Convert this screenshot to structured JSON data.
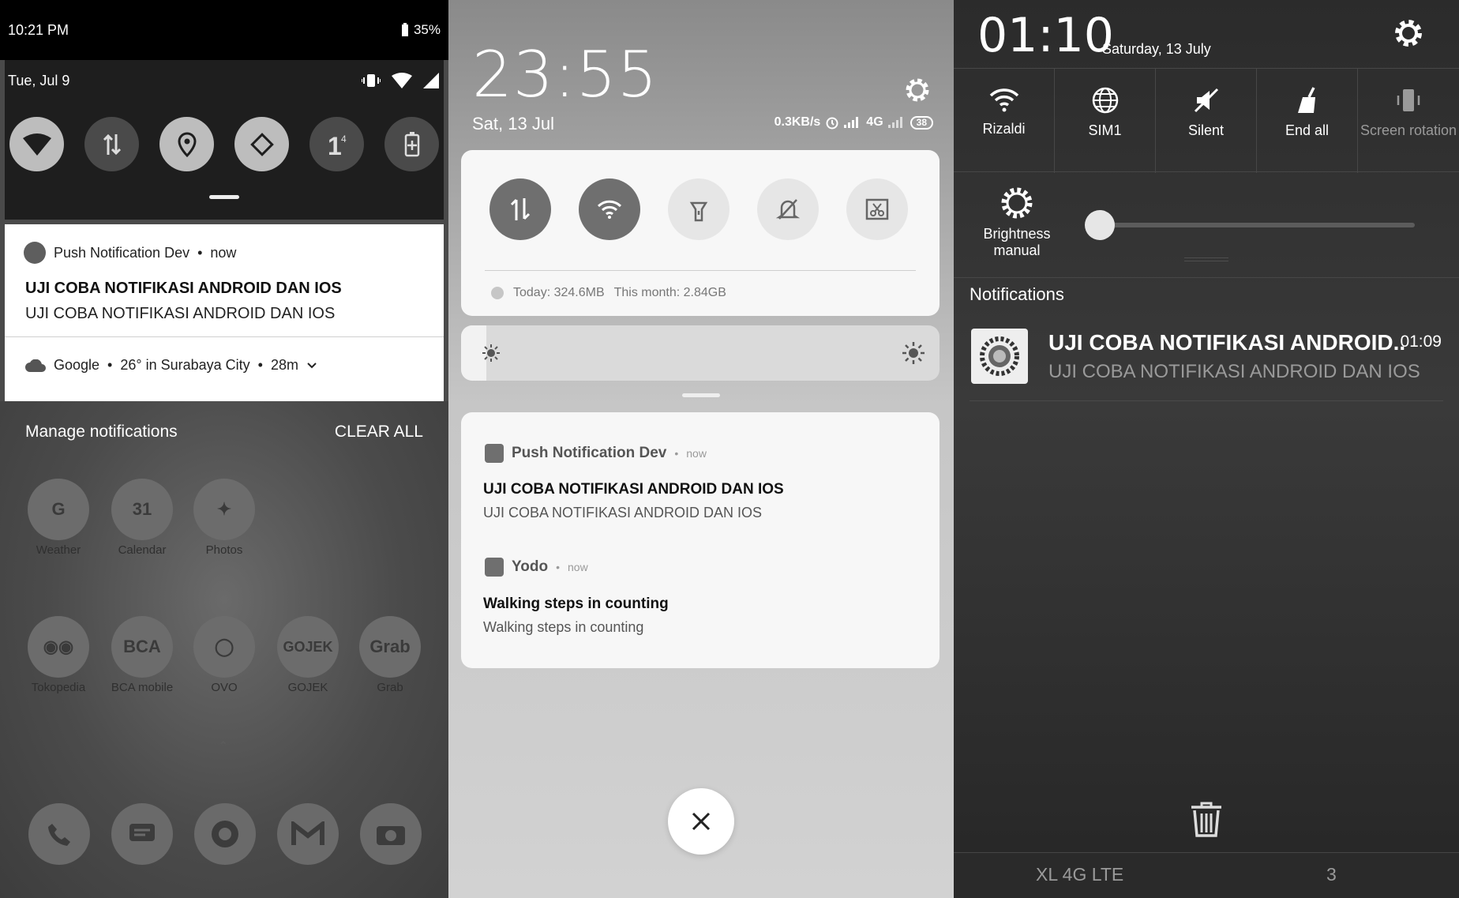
{
  "panel1": {
    "status": {
      "time": "10:21 PM",
      "battery": "35%"
    },
    "qs": {
      "date": "Tue, Jul 9"
    },
    "notification": {
      "app": "Push Notification Dev",
      "when": "now",
      "title": "UJI COBA NOTIFIKASI ANDROID DAN IOS",
      "body": "UJI COBA NOTIFIKASI ANDROID DAN IOS"
    },
    "weather": {
      "app": "Google",
      "summary": "26° in Surabaya City",
      "age": "28m"
    },
    "footer": {
      "manage": "Manage notifications",
      "clear": "CLEAR ALL"
    },
    "home_apps": [
      {
        "label": "Weather",
        "glyph": "G"
      },
      {
        "label": "Calendar",
        "glyph": "31"
      },
      {
        "label": "Photos",
        "glyph": "✦"
      },
      {
        "label": "Tokopedia",
        "glyph": "◉◉"
      },
      {
        "label": "BCA mobile",
        "glyph": "BCA"
      },
      {
        "label": "OVO",
        "glyph": "◯"
      },
      {
        "label": "GOJEK",
        "glyph": "GOJEK"
      },
      {
        "label": "Grab",
        "glyph": "Grab"
      }
    ]
  },
  "panel2": {
    "clock": "23:55",
    "date": "Sat, 13 Jul",
    "status": {
      "speed": "0.3KB/s",
      "network": "4G",
      "battery": "38"
    },
    "usage": {
      "today": "Today: 324.6MB",
      "month": "This month: 2.84GB"
    },
    "brightness_level": 0.05,
    "notifications": [
      {
        "app": "Push Notification Dev",
        "when": "now",
        "title": "UJI COBA NOTIFIKASI ANDROID DAN IOS",
        "body": "UJI COBA NOTIFIKASI ANDROID DAN IOS"
      },
      {
        "app": "Yodo",
        "when": "now",
        "title": "Walking steps in counting",
        "body": "Walking steps in counting"
      }
    ]
  },
  "panel3": {
    "clock": "01:10",
    "date": "Saturday, 13 July",
    "toggles": [
      {
        "label": "Rizaldi",
        "icon": "wifi-icon"
      },
      {
        "label": "SIM1",
        "icon": "globe-icon"
      },
      {
        "label": "Silent",
        "icon": "silent-icon"
      },
      {
        "label": "End all",
        "icon": "broom-icon"
      },
      {
        "label": "Screen rotation",
        "icon": "rotation-icon"
      }
    ],
    "brightness": {
      "label1": "Brightness",
      "label2": "manual",
      "level": 0.0
    },
    "notifications_header": "Notifications",
    "notification": {
      "title": "UJI COBA NOTIFIKASI ANDROID..",
      "time": "01:09",
      "body": "UJI COBA NOTIFIKASI ANDROID DAN IOS"
    },
    "bottom": {
      "carrier": "XL 4G LTE",
      "count": "3"
    }
  }
}
